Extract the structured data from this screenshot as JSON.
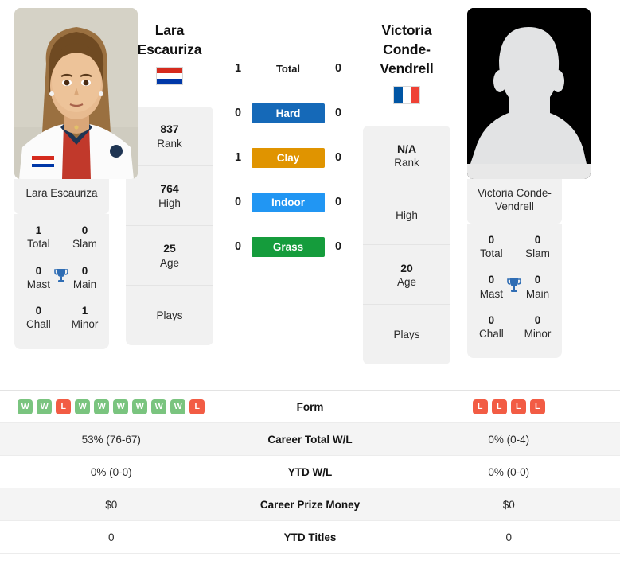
{
  "players": {
    "left": {
      "name": "Lara Escauriza",
      "name_line1": "Lara",
      "name_line2": "Escauriza",
      "caption": "Lara Escauriza",
      "country": "Paraguay",
      "flag_orientation": "horizontal",
      "flag_colors": [
        "#d52b1e",
        "#ffffff",
        "#0038a8"
      ],
      "photo_type": "portrait-photo",
      "rank": "837",
      "rank_label": "Rank",
      "high": "764",
      "high_label": "High",
      "age": "25",
      "age_label": "Age",
      "plays": "",
      "plays_label": "Plays",
      "titles": {
        "total": "1",
        "total_label": "Total",
        "slam": "0",
        "slam_label": "Slam",
        "mast": "0",
        "mast_label": "Mast",
        "main": "0",
        "main_label": "Main",
        "chall": "0",
        "chall_label": "Chall",
        "minor": "1",
        "minor_label": "Minor"
      },
      "form": [
        "W",
        "W",
        "L",
        "W",
        "W",
        "W",
        "W",
        "W",
        "W",
        "L"
      ],
      "career_wl": "53% (76-67)",
      "ytd_wl": "0% (0-0)",
      "career_prize": "$0",
      "ytd_titles": "0"
    },
    "right": {
      "name": "Victoria Conde-Vendrell",
      "name_line1": "Victoria Conde-",
      "name_line2": "Vendrell",
      "caption": "Victoria Conde-Vendrell",
      "country": "France",
      "flag_orientation": "vertical",
      "flag_colors": [
        "#0055a4",
        "#ffffff",
        "#ef4135"
      ],
      "photo_type": "silhouette-placeholder",
      "rank": "N/A",
      "rank_label": "Rank",
      "high": "",
      "high_label": "High",
      "age": "20",
      "age_label": "Age",
      "plays": "",
      "plays_label": "Plays",
      "titles": {
        "total": "0",
        "total_label": "Total",
        "slam": "0",
        "slam_label": "Slam",
        "mast": "0",
        "mast_label": "Mast",
        "main": "0",
        "main_label": "Main",
        "chall": "0",
        "chall_label": "Chall",
        "minor": "0",
        "minor_label": "Minor"
      },
      "form": [
        "L",
        "L",
        "L",
        "L"
      ],
      "career_wl": "0% (0-4)",
      "ytd_wl": "0% (0-0)",
      "career_prize": "$0",
      "ytd_titles": "0"
    }
  },
  "surfaces": [
    {
      "key": "total",
      "label": "Total",
      "left": "1",
      "right": "0",
      "color": "",
      "style": "plain"
    },
    {
      "key": "hard",
      "label": "Hard",
      "left": "0",
      "right": "0",
      "color": "#1569b8",
      "style": "pill"
    },
    {
      "key": "clay",
      "label": "Clay",
      "left": "1",
      "right": "0",
      "color": "#e09400",
      "style": "pill"
    },
    {
      "key": "indoor",
      "label": "Indoor",
      "left": "0",
      "right": "0",
      "color": "#2196f3",
      "style": "pill"
    },
    {
      "key": "grass",
      "label": "Grass",
      "left": "0",
      "right": "0",
      "color": "#159c3c",
      "style": "pill"
    }
  ],
  "table_rows": [
    {
      "key": "form",
      "label": "Form",
      "type": "form"
    },
    {
      "key": "career_wl",
      "label": "Career Total W/L",
      "type": "text",
      "left": "53% (76-67)",
      "right": "0% (0-4)"
    },
    {
      "key": "ytd_wl",
      "label": "YTD W/L",
      "type": "text",
      "left": "0% (0-0)",
      "right": "0% (0-0)"
    },
    {
      "key": "career_prize",
      "label": "Career Prize Money",
      "type": "text",
      "left": "$0",
      "right": "$0"
    },
    {
      "key": "ytd_titles",
      "label": "YTD Titles",
      "type": "text",
      "left": "0",
      "right": "0"
    }
  ],
  "icons": {
    "trophy": "trophy-icon",
    "trophy_glyph": "🏆"
  },
  "colors": {
    "win_badge": "#7ac47f",
    "loss_badge": "#f25c44",
    "trophy": "#2f6db4",
    "panel_bg": "#f1f1f1",
    "row_alt_bg": "#f4f4f4"
  }
}
